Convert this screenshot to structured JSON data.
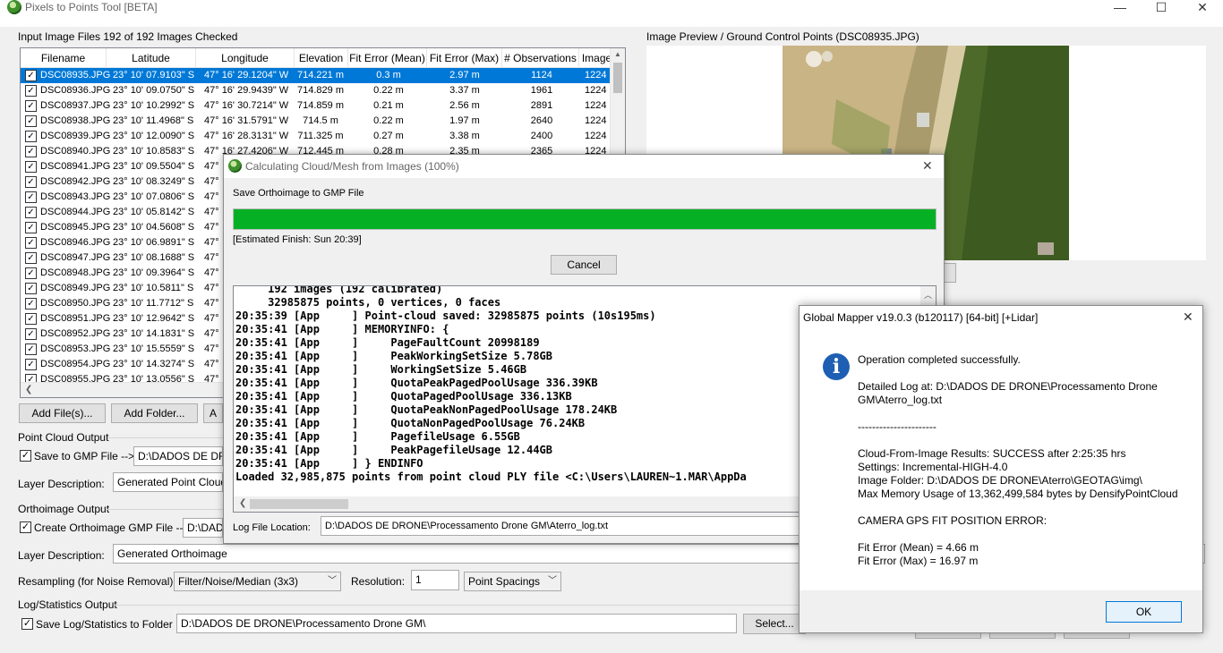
{
  "window": {
    "title": "Pixels to Points Tool [BETA]",
    "minimize": "—",
    "maximize": "☐",
    "close": "✕"
  },
  "input_files": {
    "label": "Input Image Files 192 of 192 Images Checked",
    "columns": [
      "Filename",
      "Latitude",
      "Longitude",
      "Elevation",
      "Fit Error (Mean)",
      "Fit Error (Max)",
      "# Observations",
      "Image"
    ],
    "rows": [
      {
        "file": "DSC08935.JPG",
        "lat": "23° 10' 07.9103\" S",
        "lon": "47° 16' 29.1204\" W",
        "elev": "714.221 m",
        "fmean": "0.3 m",
        "fmax": "2.97 m",
        "obs": "1124",
        "img": "1224"
      },
      {
        "file": "DSC08936.JPG",
        "lat": "23° 10' 09.0750\" S",
        "lon": "47° 16' 29.9439\" W",
        "elev": "714.829 m",
        "fmean": "0.22 m",
        "fmax": "3.37 m",
        "obs": "1961",
        "img": "1224"
      },
      {
        "file": "DSC08937.JPG",
        "lat": "23° 10' 10.2992\" S",
        "lon": "47° 16' 30.7214\" W",
        "elev": "714.859 m",
        "fmean": "0.21 m",
        "fmax": "2.56 m",
        "obs": "2891",
        "img": "1224"
      },
      {
        "file": "DSC08938.JPG",
        "lat": "23° 10' 11.4968\" S",
        "lon": "47° 16' 31.5791\" W",
        "elev": "714.5 m",
        "fmean": "0.22 m",
        "fmax": "1.97 m",
        "obs": "2640",
        "img": "1224"
      },
      {
        "file": "DSC08939.JPG",
        "lat": "23° 10' 12.0090\" S",
        "lon": "47° 16' 28.3131\" W",
        "elev": "711.325 m",
        "fmean": "0.27 m",
        "fmax": "3.38 m",
        "obs": "2400",
        "img": "1224"
      },
      {
        "file": "DSC08940.JPG",
        "lat": "23° 10' 10.8583\" S",
        "lon": "47° 16' 27.4206\" W",
        "elev": "712.445 m",
        "fmean": "0.28 m",
        "fmax": "2.35 m",
        "obs": "2365",
        "img": "1224"
      },
      {
        "file": "DSC08941.JPG",
        "lat": "23° 10' 09.5504\" S",
        "lon": "47°",
        "elev": "",
        "fmean": "",
        "fmax": "",
        "obs": "",
        "img": ""
      },
      {
        "file": "DSC08942.JPG",
        "lat": "23° 10' 08.3249\" S",
        "lon": "47°",
        "elev": "",
        "fmean": "",
        "fmax": "",
        "obs": "",
        "img": ""
      },
      {
        "file": "DSC08943.JPG",
        "lat": "23° 10' 07.0806\" S",
        "lon": "47°",
        "elev": "",
        "fmean": "",
        "fmax": "",
        "obs": "",
        "img": ""
      },
      {
        "file": "DSC08944.JPG",
        "lat": "23° 10' 05.8142\" S",
        "lon": "47°",
        "elev": "",
        "fmean": "",
        "fmax": "",
        "obs": "",
        "img": ""
      },
      {
        "file": "DSC08945.JPG",
        "lat": "23° 10' 04.5608\" S",
        "lon": "47°",
        "elev": "",
        "fmean": "",
        "fmax": "",
        "obs": "",
        "img": ""
      },
      {
        "file": "DSC08946.JPG",
        "lat": "23° 10' 06.9891\" S",
        "lon": "47°",
        "elev": "",
        "fmean": "",
        "fmax": "",
        "obs": "",
        "img": ""
      },
      {
        "file": "DSC08947.JPG",
        "lat": "23° 10' 08.1688\" S",
        "lon": "47°",
        "elev": "",
        "fmean": "",
        "fmax": "",
        "obs": "",
        "img": ""
      },
      {
        "file": "DSC08948.JPG",
        "lat": "23° 10' 09.3964\" S",
        "lon": "47°",
        "elev": "",
        "fmean": "",
        "fmax": "",
        "obs": "",
        "img": ""
      },
      {
        "file": "DSC08949.JPG",
        "lat": "23° 10' 10.5811\" S",
        "lon": "47°",
        "elev": "",
        "fmean": "",
        "fmax": "",
        "obs": "",
        "img": ""
      },
      {
        "file": "DSC08950.JPG",
        "lat": "23° 10' 11.7712\" S",
        "lon": "47°",
        "elev": "",
        "fmean": "",
        "fmax": "",
        "obs": "",
        "img": ""
      },
      {
        "file": "DSC08951.JPG",
        "lat": "23° 10' 12.9642\" S",
        "lon": "47°",
        "elev": "",
        "fmean": "",
        "fmax": "",
        "obs": "",
        "img": ""
      },
      {
        "file": "DSC08952.JPG",
        "lat": "23° 10' 14.1831\" S",
        "lon": "47°",
        "elev": "",
        "fmean": "",
        "fmax": "",
        "obs": "",
        "img": ""
      },
      {
        "file": "DSC08953.JPG",
        "lat": "23° 10' 15.5559\" S",
        "lon": "47°",
        "elev": "",
        "fmean": "",
        "fmax": "",
        "obs": "",
        "img": ""
      },
      {
        "file": "DSC08954.JPG",
        "lat": "23° 10' 14.3274\" S",
        "lon": "47°",
        "elev": "",
        "fmean": "",
        "fmax": "",
        "obs": "",
        "img": ""
      },
      {
        "file": "DSC08955.JPG",
        "lat": "23° 10' 13.0556\" S",
        "lon": "47°",
        "elev": "",
        "fmean": "",
        "fmax": "",
        "obs": "",
        "img": ""
      }
    ],
    "add_files": "Add File(s)...",
    "add_folder": "Add Folder...",
    "add_more": "A"
  },
  "preview": {
    "label": "Image Preview / Ground Control Points (DSC08935.JPG)"
  },
  "point_cloud": {
    "group": "Point Cloud Output",
    "save_label": "Save to GMP File -->",
    "save_path": "D:\\DADOS DE DRON",
    "layer_label": "Layer Description:",
    "layer_value": "Generated Point Cloud"
  },
  "orthoimage": {
    "group": "Orthoimage Output",
    "create_label": "Create Orthoimage GMP File -->",
    "create_path": "D:\\DADOS DE",
    "layer_label": "Layer Description:",
    "layer_value": "Generated Orthoimage",
    "resampling_label": "Resampling (for Noise Removal):",
    "resampling_value": "Filter/Noise/Median (3x3)",
    "resolution_label": "Resolution:",
    "resolution_value": "1",
    "units_value": "Point Spacings"
  },
  "log_stats": {
    "group": "Log/Statistics Output",
    "save_label": "Save Log/Statistics to Folder",
    "path": "D:\\DADOS DE DRONE\\Processamento Drone GM\\",
    "select_button": "Select..."
  },
  "progress_dialog": {
    "title": "Calculating Cloud/Mesh from Images (100%)",
    "close": "✕",
    "status": "Save Orthoimage to GMP File",
    "progress_fraction": 1.0,
    "estimate": "[Estimated Finish: Sun 20:39]",
    "cancel": "Cancel",
    "log_lines": [
      "     192 images (192 calibrated)",
      "     32985875 points, 0 vertices, 0 faces",
      "20:35:39 [App     ] Point-cloud saved: 32985875 points (10s195ms)",
      "20:35:41 [App     ] MEMORYINFO: {",
      "20:35:41 [App     ]     PageFaultCount 20998189",
      "20:35:41 [App     ]     PeakWorkingSetSize 5.78GB",
      "20:35:41 [App     ]     WorkingSetSize 5.46GB",
      "20:35:41 [App     ]     QuotaPeakPagedPoolUsage 336.39KB",
      "20:35:41 [App     ]     QuotaPagedPoolUsage 336.13KB",
      "20:35:41 [App     ]     QuotaPeakNonPagedPoolUsage 178.24KB",
      "20:35:41 [App     ]     QuotaNonPagedPoolUsage 76.24KB",
      "20:35:41 [App     ]     PagefileUsage 6.55GB",
      "20:35:41 [App     ]     PeakPagefileUsage 12.44GB",
      "20:35:41 [App     ] } ENDINFO",
      "Loaded 32,985,875 points from point cloud PLY file <C:\\Users\\LAUREN~1.MAR\\AppDa"
    ],
    "log_file_label": "Log File Location:",
    "log_file_path": "D:\\DADOS DE DRONE\\Processamento Drone GM\\Aterro_log.txt"
  },
  "gm_dialog": {
    "title": "Global Mapper v19.0.3 (b120117) [64-bit] [+Lidar]",
    "close": "✕",
    "lines": [
      "Operation completed successfully.",
      "",
      "Detailed Log at: D:\\DADOS DE DRONE\\Processamento Drone",
      "GM\\Aterro_log.txt",
      "",
      "----------------------",
      "",
      "Cloud-From-Image Results: SUCCESS after 2:25:35 hrs",
      "Settings: Incremental-HIGH-4.0",
      "Image Folder: D:\\DADOS DE DRONE\\Aterro\\GEOTAG\\img\\",
      "Max Memory Usage of 13,362,499,584 bytes by DensifyPointCloud",
      "",
      "CAMERA GPS FIT POSITION ERROR:",
      "",
      "Fit Error (Mean) = 4.66 m",
      "Fit Error (Max) = 16.97 m"
    ],
    "ok": "OK"
  }
}
